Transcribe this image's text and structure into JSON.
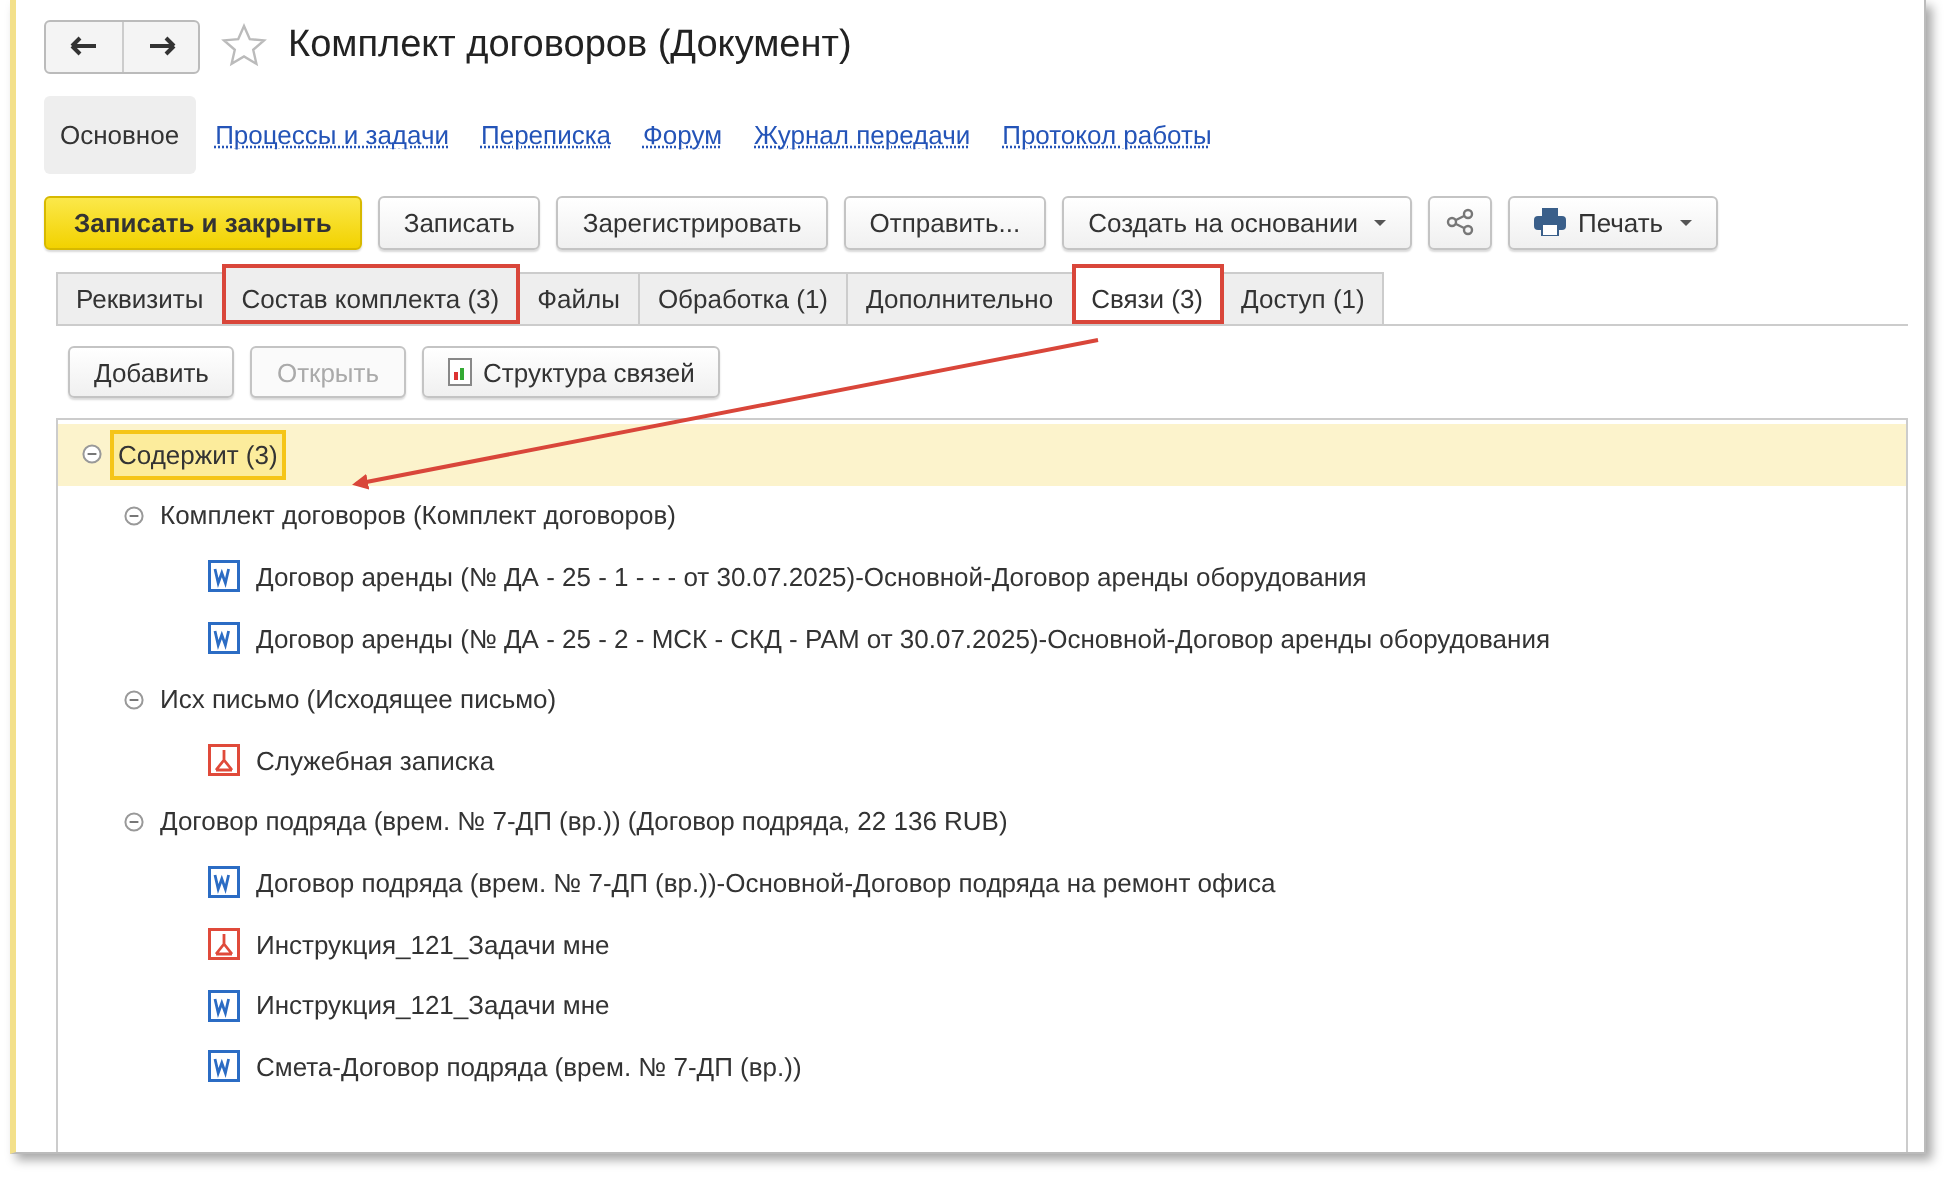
{
  "window": {
    "title": "Комплект договоров (Документ)",
    "favorite": false
  },
  "nav_links": [
    {
      "label": "Основное",
      "selected": true
    },
    {
      "label": "Процессы и задачи",
      "selected": false
    },
    {
      "label": "Переписка",
      "selected": false
    },
    {
      "label": "Форум",
      "selected": false
    },
    {
      "label": "Журнал передачи",
      "selected": false
    },
    {
      "label": "Протокол работы",
      "selected": false
    }
  ],
  "toolbar": [
    {
      "kind": "primary",
      "label": "Записать и закрыть"
    },
    {
      "kind": "plain",
      "label": "Записать"
    },
    {
      "kind": "plain",
      "label": "Зарегистрировать"
    },
    {
      "kind": "plain",
      "label": "Отправить..."
    },
    {
      "kind": "menu",
      "label": "Создать на основании"
    },
    {
      "kind": "share"
    },
    {
      "kind": "print",
      "label": "Печать"
    }
  ],
  "tabs": [
    {
      "label": "Реквизиты",
      "selected": false,
      "highlighted": false
    },
    {
      "label": "Состав комплекта (3)",
      "selected": false,
      "highlighted": true
    },
    {
      "label": "Файлы",
      "selected": false,
      "highlighted": false
    },
    {
      "label": "Обработка (1)",
      "selected": false,
      "highlighted": false
    },
    {
      "label": "Дополнительно",
      "selected": false,
      "highlighted": false
    },
    {
      "label": "Связи (3)",
      "selected": true,
      "highlighted": true
    },
    {
      "label": "Доступ (1)",
      "selected": false,
      "highlighted": false
    }
  ],
  "sub_toolbar": [
    {
      "kind": "plain",
      "label": "Добавить",
      "disabled": false
    },
    {
      "kind": "plain",
      "label": "Открыть",
      "disabled": true
    },
    {
      "kind": "structure",
      "label": "Структура связей",
      "disabled": false
    }
  ],
  "tree": [
    {
      "label": "Содержит (3)",
      "expanded": true,
      "selected": true,
      "children": [
        {
          "label": "Комплект договоров (Комплект договоров)",
          "expanded": true,
          "selected": false,
          "children": [
            {
              "kind": "word",
              "label": "Договор аренды (№ ДА - 25 - 1 -  -  - от 30.07.2025)-Основной-Договор аренды оборудования",
              "selected": false
            },
            {
              "kind": "word",
              "label": "Договор аренды (№ ДА - 25 - 2 - МСК - СКД - РАМ от 30.07.2025)-Основной-Договор аренды оборудования",
              "selected": false
            }
          ]
        },
        {
          "label": "Исх письмо (Исходящее письмо)",
          "expanded": true,
          "selected": false,
          "children": [
            {
              "kind": "pdf",
              "label": "Служебная записка",
              "selected": false
            }
          ]
        },
        {
          "label": "Договор подряда (врем. № 7-ДП (вр.)) (Договор подряда, 22 136 RUB)",
          "expanded": true,
          "selected": false,
          "children": [
            {
              "kind": "word",
              "label": "Договор подряда (врем. № 7-ДП (вр.))-Основной-Договор подряда на ремонт офиса",
              "selected": false
            },
            {
              "kind": "pdf",
              "label": "Инструкция_121_Задачи мне",
              "selected": false
            },
            {
              "kind": "word",
              "label": "Инструкция_121_Задачи мне",
              "selected": false
            },
            {
              "kind": "word",
              "label": "Смета-Договор подряда (врем. № 7-ДП (вр.))",
              "selected": false
            }
          ]
        }
      ]
    }
  ]
}
